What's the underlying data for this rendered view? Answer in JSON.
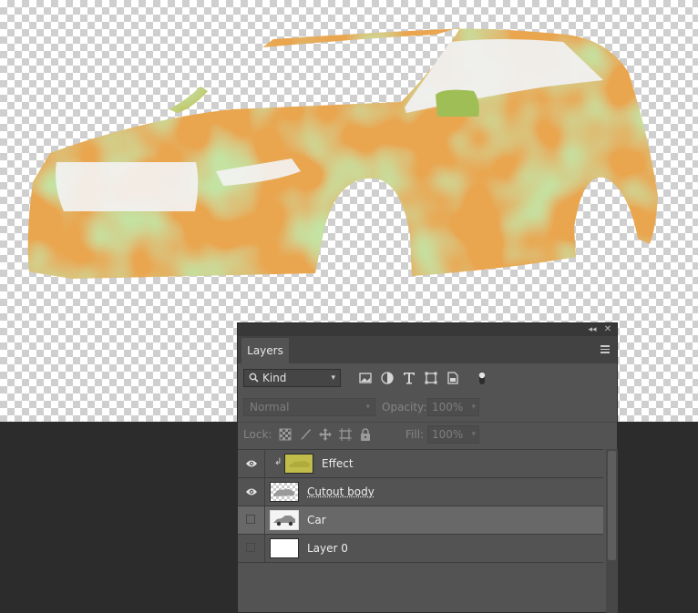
{
  "canvas": {
    "artwork_description_icon": "car-body-cutout-icon",
    "colors": {
      "green": "#8cc25c",
      "orange": "#e9a64f",
      "olive": "#c1bd4a",
      "bg_dark": "#2c2c2c"
    }
  },
  "panel": {
    "tab_label": "Layers",
    "filter": {
      "kind_label": "Kind",
      "icons": [
        "image-filter-icon",
        "adjustment-filter-icon",
        "type-filter-icon",
        "shape-filter-icon",
        "smart-object-filter-icon",
        "filter-toggle-icon"
      ]
    },
    "blend_mode": "Normal",
    "opacity_label": "Opacity:",
    "opacity_value": "100%",
    "lock_label": "Lock:",
    "lock_icons": [
      "lock-transparent-icon",
      "lock-image-icon",
      "lock-position-icon",
      "lock-artboard-icon",
      "lock-all-icon"
    ],
    "fill_label": "Fill:",
    "fill_value": "100%"
  },
  "layers": [
    {
      "name": "Effect",
      "visible": true,
      "clipped": true,
      "selected": false,
      "thumb": "olive-fill"
    },
    {
      "name": "Cutout body",
      "visible": true,
      "clipped": false,
      "selected": false,
      "thumb": "transparent-cutout"
    },
    {
      "name": "Car",
      "visible": false,
      "clipped": false,
      "selected": true,
      "thumb": "car-photo"
    },
    {
      "name": "Layer 0",
      "visible": false,
      "clipped": false,
      "selected": false,
      "thumb": "white"
    }
  ]
}
